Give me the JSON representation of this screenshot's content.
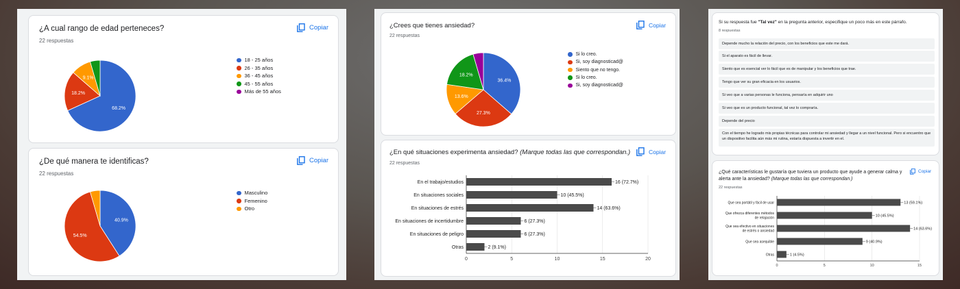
{
  "colors": {
    "blue": "#3366cc",
    "red": "#dc3912",
    "orange": "#ff9900",
    "green": "#109618",
    "purple": "#990099",
    "bar": "#4a4a4a",
    "accent": "#1a73e8"
  },
  "copy_label": "Copiar",
  "copy_icon": "copy-icon",
  "q1": {
    "title": "¿A cual rango de edad perteneces?",
    "count": "22 respuestas",
    "chart_data": {
      "type": "pie",
      "labels": [
        "18 - 25 años",
        "26 - 35 años",
        "36 - 45 años",
        "45 - 55 años",
        "Más de 55 años"
      ],
      "values": [
        68.2,
        18.2,
        9.1,
        4.5,
        0
      ],
      "slice_labels": [
        "68.2%",
        "18.2%",
        "9.1%",
        "",
        ""
      ],
      "legend": "right"
    }
  },
  "q2": {
    "title": "¿De qué manera te identificas?",
    "count": "22 respuestas",
    "chart_data": {
      "type": "pie",
      "labels": [
        "Masculino",
        "Femenino",
        "Otro"
      ],
      "values": [
        40.9,
        54.5,
        4.5
      ],
      "slice_labels": [
        "40.9%",
        "54.5%",
        ""
      ],
      "legend": "right"
    }
  },
  "q3": {
    "title": "¿Crees que tienes ansiedad?",
    "count": "22 respuestas",
    "chart_data": {
      "type": "pie",
      "labels": [
        "Si lo creo.",
        "Si, soy diagnosticad@",
        "Siento que no tengo.",
        "Si lo creo.",
        "Si, soy diagnosticad@"
      ],
      "values": [
        36.4,
        27.3,
        13.6,
        18.2,
        4.5
      ],
      "slice_labels": [
        "36.4%",
        "27.3%",
        "13.6%",
        "18.2%",
        ""
      ],
      "legend": "right"
    }
  },
  "q4": {
    "title": "¿En qué situaciones experimenta ansiedad?",
    "title_italic": "(Marque todas las que correspondan.)",
    "count": "22 respuestas",
    "chart_data": {
      "type": "bar",
      "orientation": "horizontal",
      "categories": [
        "En el trabajo/estudios",
        "En situaciones sociales",
        "En situaciones de estrés",
        "En situaciones de incertidumbre",
        "En situaciones de peligro",
        "Otras"
      ],
      "values": [
        16,
        10,
        14,
        6,
        6,
        2
      ],
      "value_labels": [
        "16 (72.7%)",
        "10 (45.5%)",
        "14 (63.6%)",
        "6 (27.3%)",
        "6 (27.3%)",
        "2 (9.1%)"
      ],
      "xlim": [
        0,
        20
      ],
      "xticks": [
        "0",
        "5",
        "10",
        "15",
        "20"
      ],
      "grid": true
    }
  },
  "q5": {
    "title_pre": "Si su respuesta fue ",
    "title_bold": "\"Tal vez\"",
    "title_post": " en la pregunta anterior, especifique un poco más en este párrafo.",
    "count": "8 respuestas",
    "responses": [
      "Depende mucho la relación del precio, con los beneficios que este me dará.",
      "Si el aparato es fácil de llevar.",
      "Siento que es esencial ver lo fácil que es de manipular y los beneficios que trae.",
      "Tengo que ver su gran eficacia en los usuarios.",
      "Si veo que a varias personas le funciona, pensaría en adquirir uno",
      "Si veo que es un producto funcional, tal vez lo compraría.",
      "Depende del precio",
      "Con el tiempo he logrado mis propias técnicas para controlar mi ansiedad y llegar a un nivel funcional. Pero si encuentro que un dispositivo facilita aún más mi rutina, estaría dispuesta a invertir en el."
    ]
  },
  "q6": {
    "title_line1": "¿Qué características le gustaría que tuviera un producto que ayude a generar calma y",
    "title_line2": "alerta ante la ansiedad?",
    "title_italic": "(Marque todas las que correspondan.)",
    "count": "22 respuestas",
    "chart_data": {
      "type": "bar",
      "orientation": "horizontal",
      "categories": [
        [
          "Que sea portátil y fácil de usar"
        ],
        [
          "Que ofrezca diferentes métodos",
          "de relajación"
        ],
        [
          "Que sea efectivo en situaciones",
          "de estrés o ansiedad"
        ],
        [
          "Que sea asequible"
        ],
        [
          "Otras"
        ]
      ],
      "values": [
        13,
        10,
        14,
        9,
        1
      ],
      "value_labels": [
        "13 (59.1%)",
        "10 (45.5%)",
        "14 (63.6%)",
        "9 (40.9%)",
        "1 (4.5%)"
      ],
      "xlim": [
        0,
        15
      ],
      "xticks": [
        "0",
        "5",
        "10",
        "15"
      ],
      "grid": true
    }
  }
}
